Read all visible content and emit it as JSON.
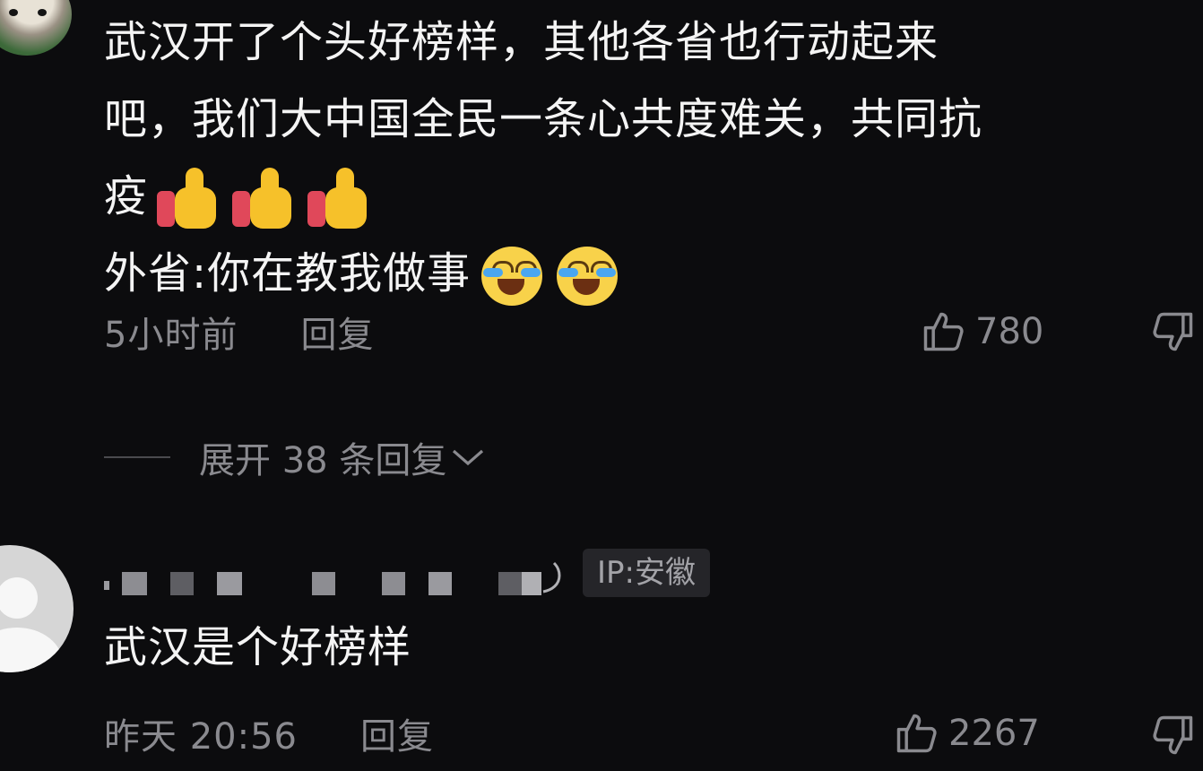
{
  "comment1": {
    "lines": [
      "武汉开了个头好榜样，其他各省也行动起来",
      "吧，我们大中国全民一条心共度难关，共同抗",
      "疫",
      "外省:你在教我做事"
    ],
    "line3_emojis": [
      "thumbs-up-emoji",
      "thumbs-up-emoji",
      "thumbs-up-emoji"
    ],
    "line4_emojis": [
      "crying-laughing-emoji",
      "crying-laughing-emoji"
    ],
    "time": "5小时前",
    "reply_label": "回复",
    "like_count": "780"
  },
  "expand": {
    "label": "展开 38 条回复"
  },
  "comment2": {
    "ip_label": "IP:安徽",
    "text": "武汉是个好榜样",
    "time": "昨天 20:56",
    "reply_label": "回复",
    "like_count": "2267"
  },
  "colors": {
    "background": "#0c0c0e",
    "primary_text": "#f4f4f4",
    "secondary_text": "#8a8a8f",
    "ip_badge_bg": "#252529"
  }
}
